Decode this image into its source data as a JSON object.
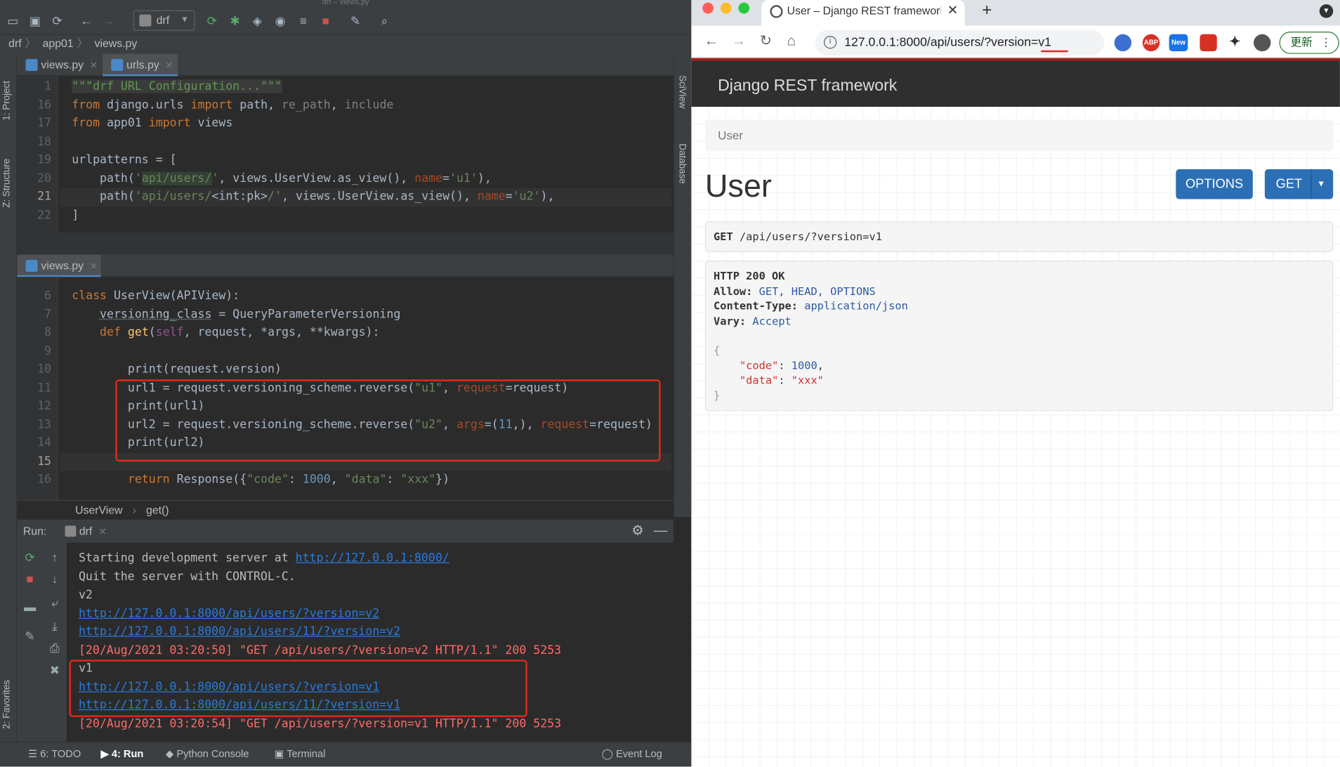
{
  "ide": {
    "title": "drf – views.py",
    "run_config": "drf",
    "breadcrumb": [
      "drf",
      "app01",
      "views.py"
    ],
    "left_tools": [
      "1: Project",
      "Z: Structure",
      "2: Favorites"
    ],
    "right_tools": [
      "SciView",
      "Database"
    ],
    "editor1": {
      "tabs": [
        {
          "label": "views.py",
          "active": false
        },
        {
          "label": "urls.py",
          "active": true
        }
      ],
      "line_numbers": [
        "1",
        "16",
        "17",
        "18",
        "19",
        "20",
        "21",
        "22"
      ],
      "current_line": "21"
    },
    "editor2": {
      "tabs": [
        {
          "label": "views.py",
          "active": true
        }
      ],
      "line_numbers": [
        "6",
        "7",
        "8",
        "9",
        "10",
        "11",
        "12",
        "13",
        "14",
        "15",
        "16"
      ],
      "current_line": "15",
      "breadcrumb": [
        "UserView",
        "get()"
      ]
    },
    "run": {
      "label": "Run:",
      "tab": "drf",
      "console": [
        {
          "text": "Starting development server at ",
          "link": "http://127.0.0.1:8000/"
        },
        {
          "text": "Quit the server with CONTROL-C."
        },
        {
          "text": "v2"
        },
        {
          "link": "http://127.0.0.1:8000/api/users/?version=v2"
        },
        {
          "link": "http://127.0.0.1:8000/api/users/11/?version=v2"
        },
        {
          "text": "[20/Aug/2021 03:20:50] \"GET /api/users/?version=v2 HTTP/1.1\" 200 5253",
          "style": "red"
        },
        {
          "text": "v1"
        },
        {
          "link": "http://127.0.0.1:8000/api/users/?version=v1"
        },
        {
          "link": "http://127.0.0.1:8000/api/users/11/?version=v1"
        },
        {
          "text": "[20/Aug/2021 03:20:54] \"GET /api/users/?version=v1 HTTP/1.1\" 200 5253",
          "style": "red"
        }
      ]
    },
    "statusbar": {
      "todo": "6: TODO",
      "run": "4: Run",
      "python_console": "Python Console",
      "terminal": "Terminal",
      "event_log": "Event Log"
    }
  },
  "browser": {
    "tab_title": "User – Django REST framework",
    "url": "127.0.0.1:8000/api/users/?version=v1",
    "ext_abp": "ABP",
    "ext_new": "New",
    "update_label": "更新",
    "drf": {
      "brand": "Django REST framework",
      "breadcrumb": "User",
      "heading": "User",
      "btn_options": "OPTIONS",
      "btn_get": "GET",
      "request_method": "GET",
      "request_path": "/api/users/?version=v1",
      "response": {
        "status": "HTTP 200 OK",
        "headers": [
          {
            "name": "Allow:",
            "value": "GET, HEAD, OPTIONS"
          },
          {
            "name": "Content-Type:",
            "value": "application/json"
          },
          {
            "name": "Vary:",
            "value": "Accept"
          }
        ],
        "json": [
          {
            "key": "\"code\"",
            "value": "1000",
            "type": "num"
          },
          {
            "key": "\"data\"",
            "value": "\"xxx\"",
            "type": "str"
          }
        ]
      }
    }
  },
  "colors": {
    "ide_bg": "#2b2b2b",
    "highlight_red": "#e1291d",
    "drf_blue": "#2c6fb4",
    "drf_nav": "#2f2f2f"
  }
}
